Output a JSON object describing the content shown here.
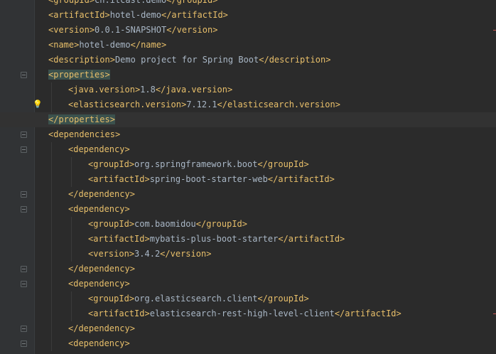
{
  "lines": [
    {
      "indent": 0,
      "tag": "groupId",
      "text": "cn.itcast.demo",
      "close": "groupId"
    },
    {
      "indent": 0,
      "tag": "artifactId",
      "text": "hotel-demo",
      "close": "artifactId"
    },
    {
      "indent": 0,
      "tag": "version",
      "text": "0.0.1-SNAPSHOT",
      "close": "version"
    },
    {
      "indent": 0,
      "tag": "name",
      "text": "hotel-demo",
      "close": "name"
    },
    {
      "indent": 0,
      "tag": "description",
      "text": "Demo project for Spring Boot",
      "close": "description"
    },
    {
      "indent": 0,
      "tag": "properties"
    },
    {
      "indent": 1,
      "tag": "java.version",
      "text": "1.8",
      "close": "java.version"
    },
    {
      "indent": 1,
      "tag": "elasticsearch.version",
      "text": "7.12.1",
      "close": "elasticsearch.version"
    },
    {
      "indent": 0,
      "close": "properties"
    },
    {
      "indent": 0,
      "tag": "dependencies"
    },
    {
      "indent": 1,
      "tag": "dependency"
    },
    {
      "indent": 2,
      "tag": "groupId",
      "text": "org.springframework.boot",
      "close": "groupId"
    },
    {
      "indent": 2,
      "tag": "artifactId",
      "text": "spring-boot-starter-web",
      "close": "artifactId"
    },
    {
      "indent": 1,
      "close": "dependency"
    },
    {
      "indent": 1,
      "tag": "dependency"
    },
    {
      "indent": 2,
      "tag": "groupId",
      "text": "com.baomidou",
      "close": "groupId"
    },
    {
      "indent": 2,
      "tag": "artifactId",
      "text": "mybatis-plus-boot-starter",
      "close": "artifactId"
    },
    {
      "indent": 2,
      "tag": "version",
      "text": "3.4.2",
      "close": "version"
    },
    {
      "indent": 1,
      "close": "dependency"
    },
    {
      "indent": 1,
      "tag": "dependency"
    },
    {
      "indent": 2,
      "tag": "groupId",
      "text": "org.elasticsearch.client",
      "close": "groupId"
    },
    {
      "indent": 2,
      "tag": "artifactId",
      "text": "elasticsearch-rest-high-level-client",
      "close": "artifactId"
    },
    {
      "indent": 1,
      "close": "dependency"
    },
    {
      "indent": 1,
      "tag": "dependency"
    }
  ],
  "colors": {
    "background": "#2b2b2b",
    "gutter": "#313335",
    "tag": "#e8bf6a",
    "text": "#a9b7c6",
    "tag_highlight": "#3b514d",
    "current_line": "#323232"
  },
  "intention_icon": "lightbulb-icon"
}
